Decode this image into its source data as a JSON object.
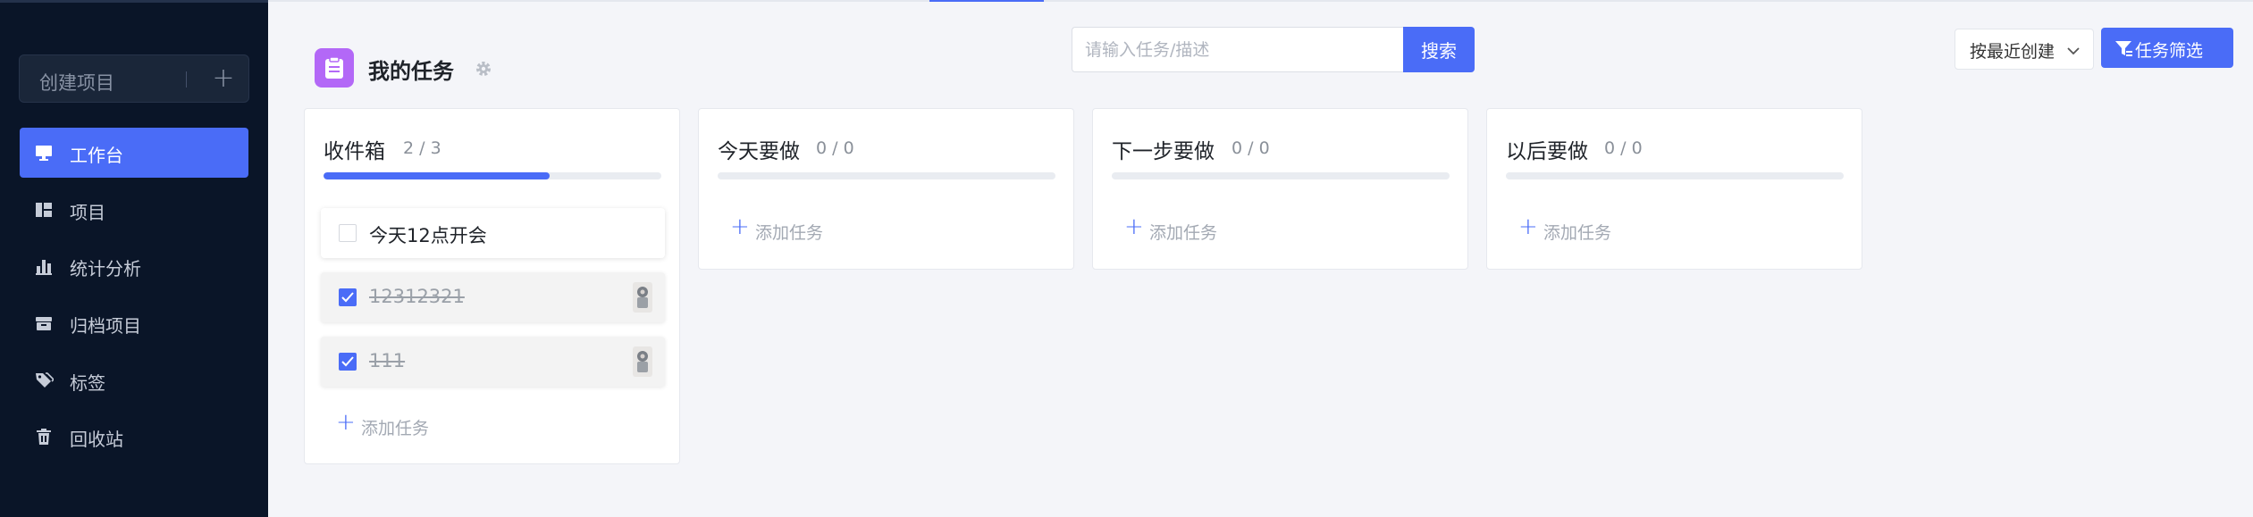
{
  "sidebar": {
    "create_project_label": "创建项目",
    "create_project_plus": "+",
    "items": [
      {
        "label": "工作台",
        "icon": "monitor-icon",
        "active": true
      },
      {
        "label": "项目",
        "icon": "board-icon",
        "active": false
      },
      {
        "label": "统计分析",
        "icon": "bar-chart-icon",
        "active": false
      },
      {
        "label": "归档项目",
        "icon": "archive-box-icon",
        "active": false
      },
      {
        "label": "标签",
        "icon": "tags-icon",
        "active": false
      },
      {
        "label": "回收站",
        "icon": "trash-icon",
        "active": false
      }
    ]
  },
  "header": {
    "title": "我的任务",
    "title_icon": "clipboard-icon",
    "settings_icon": "gear-icon",
    "search": {
      "placeholder": "请输入任务/描述",
      "value": "",
      "button_label": "搜索"
    },
    "sort": {
      "selected": "按最近创建",
      "icon": "chevron-down-icon"
    },
    "filter_button": {
      "label": "任务筛选",
      "icon": "filter-icon"
    }
  },
  "columns": [
    {
      "title": "收件箱",
      "count": "2 / 3",
      "progress": 0.67,
      "tasks": [
        {
          "title": "今天12点开会",
          "done": false
        },
        {
          "title": "12312321",
          "done": true
        },
        {
          "title": "111",
          "done": true
        }
      ],
      "add_label": "添加任务"
    },
    {
      "title": "今天要做",
      "count": "0 / 0",
      "progress": 0,
      "tasks": [],
      "add_label": "添加任务"
    },
    {
      "title": "下一步要做",
      "count": "0 / 0",
      "progress": 0,
      "tasks": [],
      "add_label": "添加任务"
    },
    {
      "title": "以后要做",
      "count": "0 / 0",
      "progress": 0,
      "tasks": [],
      "add_label": "添加任务"
    }
  ],
  "colors": {
    "accent": "#4a6cf7",
    "sidebar_bg": "#0a1528",
    "title_icon_bg": "#b368f7",
    "page_bg": "#f4f5f9"
  }
}
